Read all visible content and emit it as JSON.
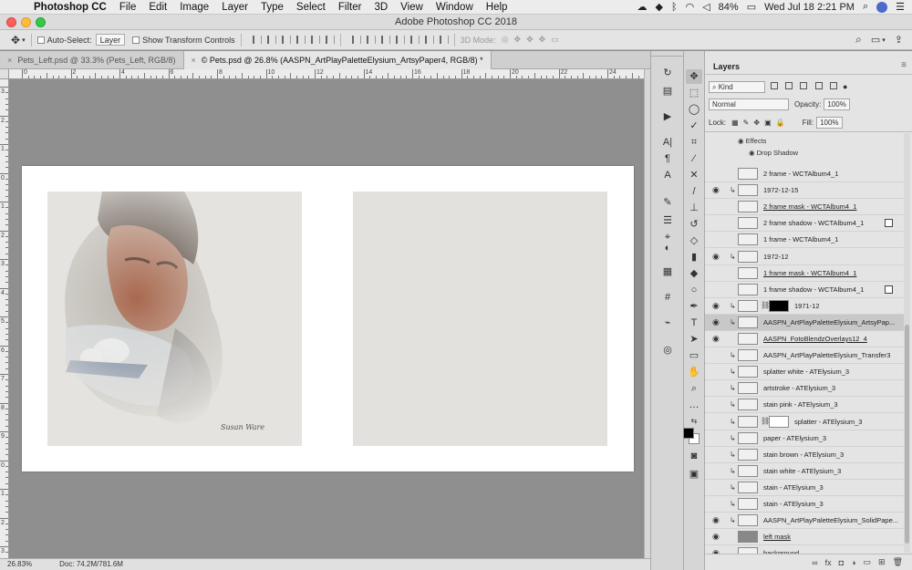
{
  "menubar": {
    "app_name": "Photoshop CC",
    "items": [
      "File",
      "Edit",
      "Image",
      "Layer",
      "Type",
      "Select",
      "Filter",
      "3D",
      "View",
      "Window",
      "Help"
    ],
    "battery": "84%",
    "datetime": "Wed Jul 18  2:21 PM"
  },
  "window": {
    "title": "Adobe Photoshop CC 2018"
  },
  "options_bar": {
    "auto_select_label": "Auto-Select:",
    "auto_select_value": "Layer",
    "show_transform_label": "Show Transform Controls",
    "mode_3d_label": "3D Mode:"
  },
  "tabs": [
    {
      "close": "×",
      "label": "Pets_Left.psd @ 33.3% (Pets_Left, RGB/8)"
    },
    {
      "close": "×",
      "label": "© Pets.psd @ 26.8% (AASPN_ArtPlayPaletteElysium_ArtsyPaper4, RGB/8) *"
    }
  ],
  "ruler_h": [
    "0",
    "2",
    "4",
    "6",
    "8",
    "10",
    "12",
    "14",
    "16",
    "18",
    "20",
    "22",
    "24"
  ],
  "ruler_v": [
    "3",
    "2",
    "1",
    "0",
    "1",
    "2",
    "3",
    "4",
    "5",
    "6",
    "7",
    "8",
    "9",
    "0",
    "1",
    "2",
    "3"
  ],
  "canvas": {
    "signature": "Susan Ware"
  },
  "status": {
    "zoom": "26.83%",
    "doc": "Doc: 74.2M/781.6M"
  },
  "layers_panel": {
    "title": "Layers",
    "filter_kind": "Kind",
    "blend_mode": "Normal",
    "opacity_label": "Opacity:",
    "opacity_value": "100%",
    "lock_label": "Lock:",
    "fill_label": "Fill:",
    "fill_value": "100%",
    "effects_label": "Effects",
    "drop_shadow_label": "Drop Shadow",
    "layers": [
      {
        "name": "2 frame - WCTAlbum4_1",
        "visible": false,
        "clipped": false,
        "underline": false
      },
      {
        "name": "1972-12-15",
        "visible": true,
        "clipped": true,
        "underline": false
      },
      {
        "name": "2 frame mask - WCTAlbum4_1",
        "visible": false,
        "clipped": false,
        "underline": true
      },
      {
        "name": "2 frame shadow - WCTAlbum4_1",
        "visible": false,
        "clipped": false,
        "underline": false,
        "fx": true
      },
      {
        "name": "1 frame - WCTAlbum4_1",
        "visible": false,
        "clipped": false,
        "underline": false
      },
      {
        "name": "1972-12",
        "visible": true,
        "clipped": true,
        "underline": false
      },
      {
        "name": "1 frame mask - WCTAlbum4_1",
        "visible": false,
        "clipped": false,
        "underline": true
      },
      {
        "name": "1 frame shadow - WCTAlbum4_1",
        "visible": false,
        "clipped": false,
        "underline": false,
        "fx": true
      },
      {
        "name": "1971-12",
        "visible": true,
        "clipped": true,
        "underline": false,
        "mask": "black"
      },
      {
        "name": "AASPN_ArtPlayPaletteElysium_ArtsyPap...",
        "visible": true,
        "clipped": true,
        "underline": false,
        "selected": true
      },
      {
        "name": "AASPN_FotoBlendzOverlays12_4",
        "visible": true,
        "clipped": false,
        "underline": true
      },
      {
        "name": "AASPN_ArtPlayPaletteElysium_Transfer3",
        "visible": false,
        "clipped": true,
        "underline": false
      },
      {
        "name": "splatter white - ATElysium_3",
        "visible": false,
        "clipped": true,
        "underline": false
      },
      {
        "name": "artstroke - ATElysium_3",
        "visible": false,
        "clipped": true,
        "underline": false
      },
      {
        "name": "stain pink - ATElysium_3",
        "visible": false,
        "clipped": true,
        "underline": false
      },
      {
        "name": "splatter - ATElysium_3",
        "visible": false,
        "clipped": true,
        "underline": false,
        "mask": "white"
      },
      {
        "name": "paper - ATElysium_3",
        "visible": false,
        "clipped": true,
        "underline": false
      },
      {
        "name": "stain brown - ATElysium_3",
        "visible": false,
        "clipped": true,
        "underline": false
      },
      {
        "name": "stain white - ATElysium_3",
        "visible": false,
        "clipped": true,
        "underline": false
      },
      {
        "name": "stain - ATElysium_3",
        "visible": false,
        "clipped": true,
        "underline": false
      },
      {
        "name": "stain - ATElysium_3",
        "visible": false,
        "clipped": true,
        "underline": false
      },
      {
        "name": "AASPN_ArtPlayPaletteElysium_SolidPape...",
        "visible": true,
        "clipped": true,
        "underline": false
      },
      {
        "name": "left mask",
        "visible": true,
        "clipped": false,
        "underline": true,
        "dark": true
      },
      {
        "name": "background",
        "visible": true,
        "clipped": false,
        "underline": false
      }
    ]
  },
  "colors": {
    "canvas_bg": "#8f8f8f",
    "panel_bg": "#e4e4e4",
    "selected_layer": "#c8c8c8"
  }
}
